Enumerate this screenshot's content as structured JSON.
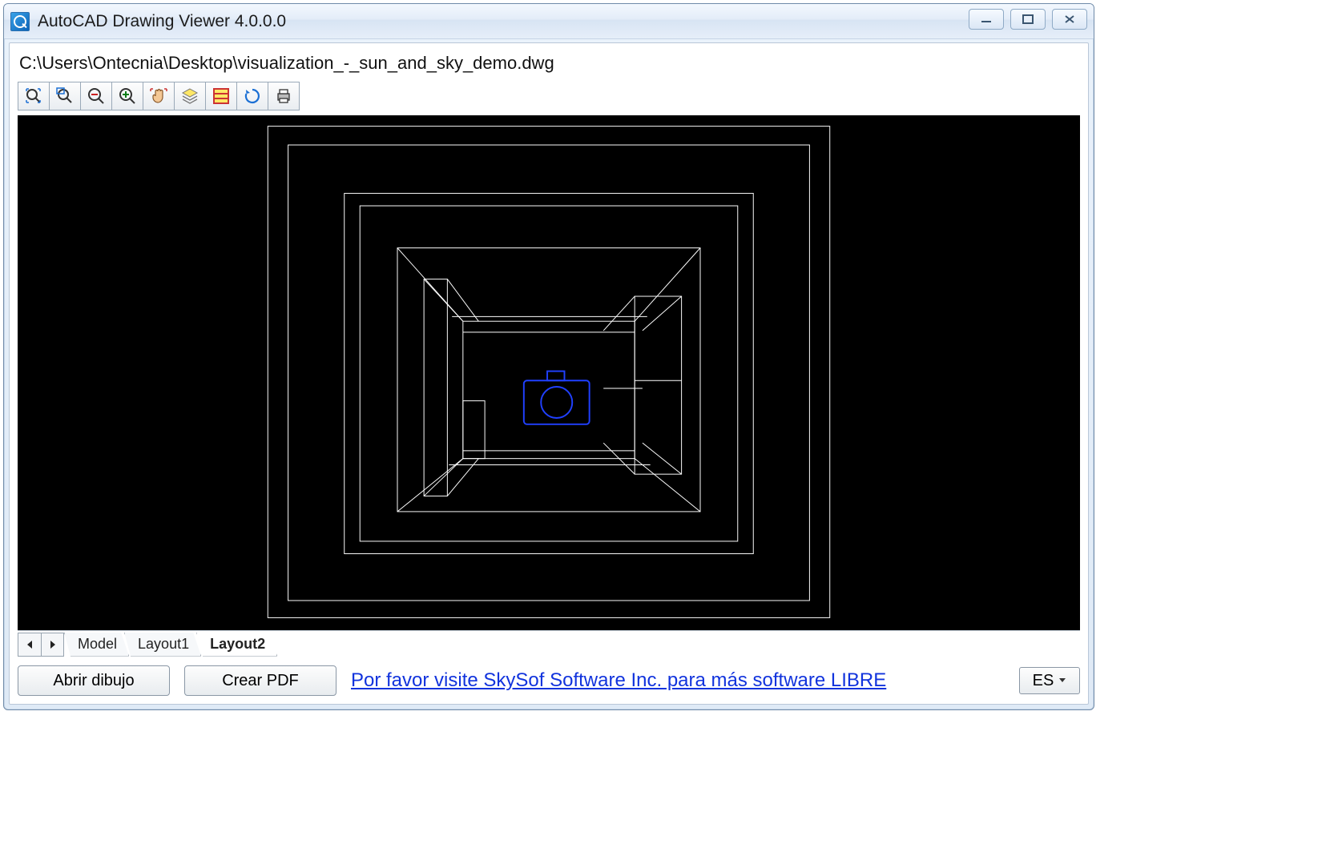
{
  "window": {
    "title": "AutoCAD Drawing Viewer 4.0.0.0"
  },
  "file": {
    "path": "C:\\Users\\Ontecnia\\Desktop\\visualization_-_sun_and_sky_demo.dwg"
  },
  "toolbar": {
    "items": [
      {
        "name": "zoom-extents-icon"
      },
      {
        "name": "zoom-window-icon"
      },
      {
        "name": "zoom-out-icon"
      },
      {
        "name": "zoom-in-icon"
      },
      {
        "name": "pan-icon"
      },
      {
        "name": "layers-icon"
      },
      {
        "name": "properties-icon"
      },
      {
        "name": "regen-icon"
      },
      {
        "name": "print-icon"
      }
    ]
  },
  "tabs": {
    "items": [
      {
        "label": "Model",
        "active": false
      },
      {
        "label": "Layout1",
        "active": false
      },
      {
        "label": "Layout2",
        "active": true
      }
    ]
  },
  "footer": {
    "open_label": "Abrir dibujo",
    "pdf_label": "Crear PDF",
    "link_text": "Por favor visite SkySof Software Inc. para más software LIBRE",
    "language": "ES"
  }
}
